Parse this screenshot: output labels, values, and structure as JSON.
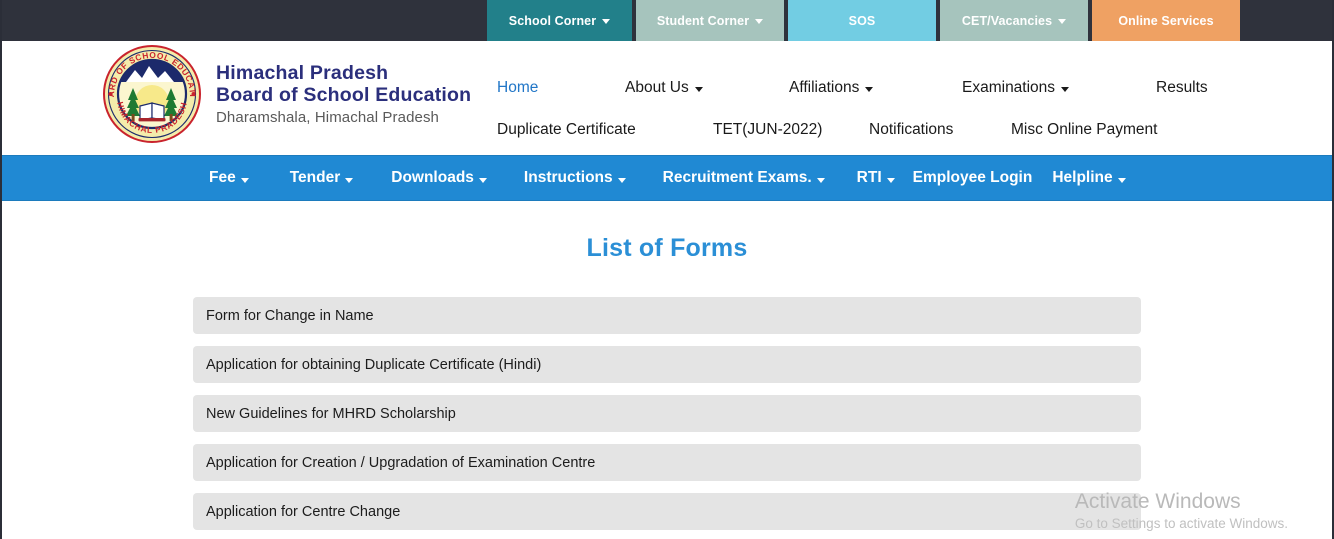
{
  "topbar": {
    "tiles": [
      {
        "label": "School Corner",
        "has_caret": true,
        "color": "#22808a",
        "name": "top-tile-school-corner"
      },
      {
        "label": "Student Corner",
        "has_caret": true,
        "color": "#a6c4bd",
        "name": "top-tile-student-corner"
      },
      {
        "label": "SOS",
        "has_caret": false,
        "color": "#72cde3",
        "name": "top-tile-sos"
      },
      {
        "label": "CET/Vacancies",
        "has_caret": true,
        "color": "#a6c4bd",
        "name": "top-tile-cet-vacancies"
      },
      {
        "label": "Online Services",
        "has_caret": false,
        "color": "#efa163",
        "name": "top-tile-online-services"
      }
    ],
    "background": "#2f323c"
  },
  "brand": {
    "line1": "Himachal Pradesh",
    "line2": "Board of School Education",
    "line3": "Dharamshala, Himachal Pradesh",
    "color": "#2b2f7c",
    "logo": {
      "outer_text_top": "BOARD OF SCHOOL EDUCATION",
      "outer_text_bottom": "HIMACHAL PRADESH",
      "ring_color": "#f2e9a0",
      "text_color": "#c9232d"
    }
  },
  "mainnav": {
    "row1": [
      {
        "label": "Home",
        "has_caret": false,
        "active": true
      },
      {
        "label": "About Us",
        "has_caret": true,
        "active": false
      },
      {
        "label": "Affiliations",
        "has_caret": true,
        "active": false
      },
      {
        "label": "Examinations",
        "has_caret": true,
        "active": false
      },
      {
        "label": "Results",
        "has_caret": false,
        "active": false
      }
    ],
    "row2": [
      {
        "label": "Duplicate Certificate",
        "has_caret": false,
        "active": false
      },
      {
        "label": "TET(JUN-2022)",
        "has_caret": false,
        "active": false
      },
      {
        "label": "Notifications",
        "has_caret": false,
        "active": false
      },
      {
        "label": "Misc Online Payment",
        "has_caret": false,
        "active": false
      }
    ],
    "active_color": "#2176c7"
  },
  "bluebar": {
    "background": "#2089d3",
    "items": [
      {
        "label": "Fee",
        "has_caret": true
      },
      {
        "label": "Tender",
        "has_caret": true
      },
      {
        "label": "Downloads",
        "has_caret": true
      },
      {
        "label": "Instructions",
        "has_caret": true
      },
      {
        "label": "Recruitment Exams.",
        "has_caret": true
      },
      {
        "label": "RTI",
        "has_caret": true
      },
      {
        "label": "Employee Login",
        "has_caret": false
      },
      {
        "label": "Helpline",
        "has_caret": true
      }
    ]
  },
  "content": {
    "page_title": "List of Forms",
    "title_color": "#2b8fd6",
    "forms": [
      "Form for Change in Name",
      "Application for obtaining Duplicate Certificate (Hindi)",
      "New Guidelines for MHRD Scholarship",
      "Application for Creation / Upgradation of Examination Centre",
      "Application for Centre Change"
    ]
  },
  "watermark": {
    "title": "Activate Windows",
    "subtitle": "Go to Settings to activate Windows."
  }
}
